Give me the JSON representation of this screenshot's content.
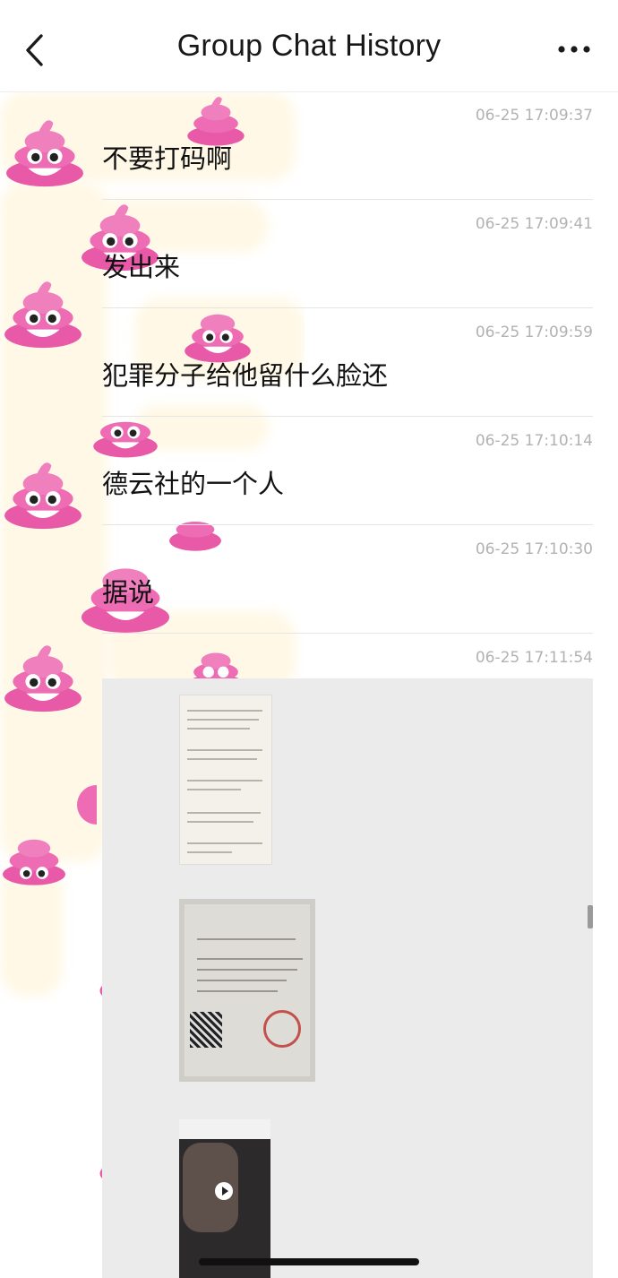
{
  "header": {
    "title": "Group Chat History",
    "back_icon": "chevron-left-icon",
    "more_icon": "ellipsis-icon"
  },
  "messages": [
    {
      "time": "06-25 17:09:37",
      "text": "不要打码啊"
    },
    {
      "time": "06-25 17:09:41",
      "text": "发出来"
    },
    {
      "time": "06-25 17:09:59",
      "text": "犯罪分子给他留什么脸还"
    },
    {
      "time": "06-25 17:10:14",
      "text": "德云社的一个人"
    },
    {
      "time": "06-25 17:10:30",
      "text": "据说"
    }
  ],
  "last_message": {
    "time": "06-25 17:11:54"
  },
  "colors": {
    "accent_pink": "#e85aa8",
    "timestamp": "#b2b2b2",
    "divider": "#e5e5e5"
  }
}
